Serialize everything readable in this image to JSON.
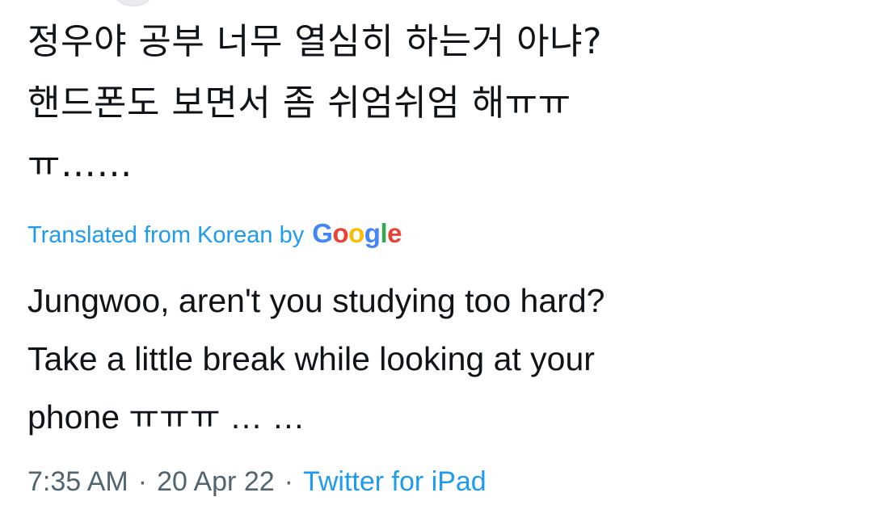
{
  "tweet": {
    "original_text": "정우야 공부 너무 열심히 하는거 아냐?\n핸드폰도 보면서 좀 쉬엄쉬엄 해ㅠㅠ\nㅠ……",
    "translated_label": "Translated from Korean by",
    "google_logo_text": "Google",
    "translated_text": "Jungwoo, aren't you studying too hard?\n Take a little break while looking at your\nphone ㅠㅠㅠ … …",
    "time": "7:35 AM",
    "date": "20 Apr 22",
    "separator": "·",
    "source": "Twitter for iPad"
  },
  "colors": {
    "link": "#1d9bf0",
    "meta": "#536471",
    "text": "#0f1419",
    "google_blue": "#4285f4",
    "google_red": "#ea4335",
    "google_yellow": "#fbbc05",
    "google_green": "#34a853"
  }
}
